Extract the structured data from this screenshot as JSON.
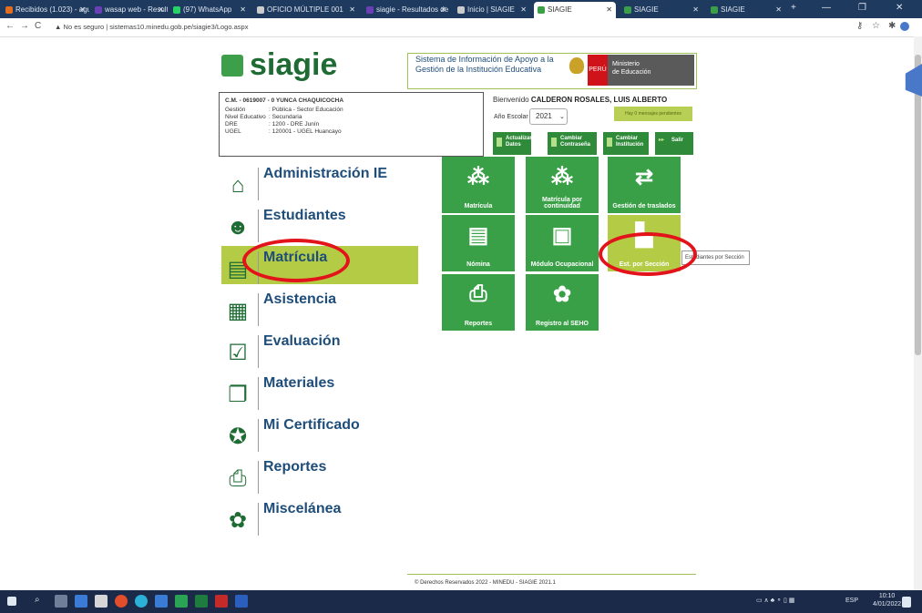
{
  "browser": {
    "tabs": [
      {
        "label": "Recibidos (1.023) - agu",
        "color": "#e06d20"
      },
      {
        "label": "wasap web - Resultad",
        "color": "#6b3fb5"
      },
      {
        "label": "(97) WhatsApp",
        "color": "#25d366"
      },
      {
        "label": "OFICIO MÚLTIPLE 001",
        "color": "#cccccc"
      },
      {
        "label": "siagie - Resultados de",
        "color": "#6b3fb5"
      },
      {
        "label": "Inicio | SIAGIE",
        "color": "#cccccc"
      },
      {
        "label": "SIAGIE",
        "color": "#3aa047"
      },
      {
        "label": "SIAGIE",
        "color": "#3aa047"
      },
      {
        "label": "SIAGIE",
        "color": "#3aa047"
      }
    ],
    "new_tab": "+",
    "security": "No es seguro",
    "url": "sistemas10.minedu.gob.pe/siagie3/Logo.aspx"
  },
  "header": {
    "logo": "siagie",
    "system_line1": "Sistema de Información de Apoyo a la",
    "system_line2": "Gestión de la Institución Educativa",
    "peru": "PERÚ",
    "ministerio1": "Ministerio",
    "ministerio2": "de Educación"
  },
  "institution": {
    "cm": "C.M. - 0619007 - 0 YUNCA CHAQUICOCHA",
    "rows": [
      {
        "k": "Gestión",
        "v": ": Pública - Sector Educación"
      },
      {
        "k": "Nivel Educativo",
        "v": ": Secundaria"
      },
      {
        "k": "DRE",
        "v": ": 1200 - DRE Junín"
      },
      {
        "k": "UGEL",
        "v": ": 120001 - UGEL Huancayo"
      }
    ]
  },
  "user": {
    "welcome": "Bienvenido",
    "name": "CALDERON ROSALES, LUIS ALBERTO",
    "year_label": "Año Escolar",
    "year": "2021",
    "messages": "Hay 0 mensajes pendientes",
    "buttons": {
      "update": "Actualizar Datos",
      "password": "Cambiar Contraseña",
      "institution": "Cambiar Institución",
      "exit": "Salir"
    }
  },
  "menu": [
    {
      "label": "Administración IE",
      "icon": "building-icon"
    },
    {
      "label": "Estudiantes",
      "icon": "students-icon"
    },
    {
      "label": "Matrícula",
      "icon": "enrollment-icon"
    },
    {
      "label": "Asistencia",
      "icon": "attendance-icon"
    },
    {
      "label": "Evaluación",
      "icon": "checkbox-icon"
    },
    {
      "label": "Materiales",
      "icon": "books-icon"
    },
    {
      "label": "Mi Certificado",
      "icon": "certificate-icon"
    },
    {
      "label": "Reportes",
      "icon": "printer-icon"
    },
    {
      "label": "Miscelánea",
      "icon": "misc-icon"
    }
  ],
  "tiles": [
    {
      "label": "Matrícula"
    },
    {
      "label": "Matrícula por continuidad"
    },
    {
      "label": "Gestión de traslados"
    },
    {
      "label": "Nómina"
    },
    {
      "label": "Módulo Ocupacional"
    },
    {
      "label": "Est. por Sección"
    },
    {
      "label": "Reportes"
    },
    {
      "label": "Registro al SEHO"
    }
  ],
  "tooltip": "Estudiantes por Sección",
  "footer": "© Derechos Reservados 2022 - MINEDU - SIAGIE 2021.1",
  "taskbar": {
    "lang": "ESP",
    "time": "10:10",
    "date": "4/01/2022"
  }
}
